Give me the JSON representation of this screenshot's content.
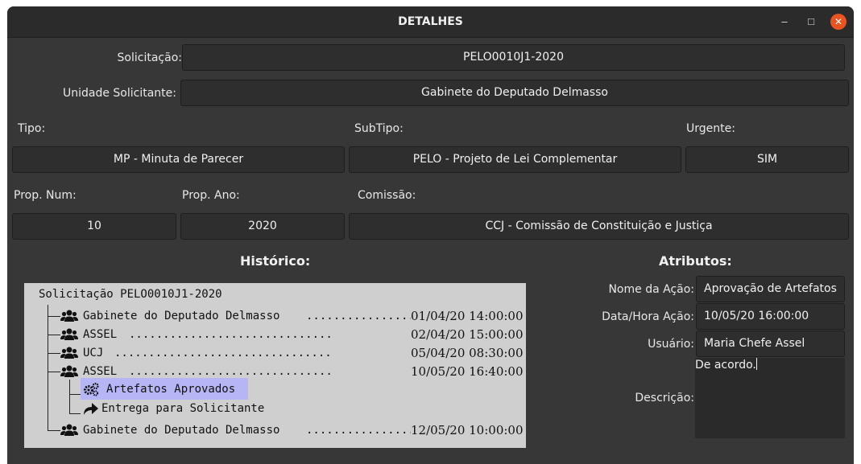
{
  "window": {
    "title": "DETALHES"
  },
  "form": {
    "solicitacao_label": "Solicitação:",
    "solicitacao_value": "PELO0010J1-2020",
    "unidade_label": "Unidade Solicitante:",
    "unidade_value": "Gabinete do Deputado Delmasso",
    "tipo_label": "Tipo:",
    "tipo_value": "MP - Minuta de Parecer",
    "subtipo_label": "SubTipo:",
    "subtipo_value": "PELO - Projeto de Lei Complementar",
    "urgente_label": "Urgente:",
    "urgente_value": "SIM",
    "propnum_label": "Prop. Num:",
    "propnum_value": "10",
    "propano_label": "Prop. Ano:",
    "propano_value": "2020",
    "comissao_label": "Comissão:",
    "comissao_value": "CCJ - Comissão de Constituição e Justiça"
  },
  "historico": {
    "heading": "Histórico:",
    "root": "Solicitação PELO0010J1-2020",
    "items": [
      {
        "name": "Gabinete do Deputado Delmasso",
        "dots": "................",
        "date": "01/04/20 14:00:00",
        "icon": "users-icon"
      },
      {
        "name": "ASSEL",
        "dots": "..............................",
        "date": "02/04/20 15:00:00",
        "icon": "users-icon"
      },
      {
        "name": "UCJ",
        "dots": "................................",
        "date": "05/04/20 08:30:00",
        "icon": "users-icon"
      },
      {
        "name": "ASSEL",
        "dots": "..............................",
        "date": "10/05/20 16:40:00",
        "icon": "users-icon"
      },
      {
        "name": "Gabinete do Deputado Delmasso",
        "dots": "................",
        "date": "12/05/20 10:00:00",
        "icon": "users-icon"
      }
    ],
    "children": [
      {
        "name": "Artefatos Aprovados",
        "icon": "gears-icon",
        "selected": true
      },
      {
        "name": "Entrega para Solicitante",
        "icon": "share-arrow-icon",
        "selected": false
      }
    ]
  },
  "atributos": {
    "heading": "Atributos:",
    "nome_acao_label": "Nome da Ação:",
    "nome_acao_value": "Aprovação de Artefatos",
    "data_hora_label": "Data/Hora Ação:",
    "data_hora_value": "10/05/20 16:00:00",
    "usuario_label": "Usuário:",
    "usuario_value": "Maria Chefe Assel",
    "descricao_label": "Descrição:",
    "descricao_value": "De acordo."
  },
  "colors": {
    "close_button": "#e95420",
    "selection": "#b6b6f5",
    "tree_bg": "#cfcfcf"
  }
}
